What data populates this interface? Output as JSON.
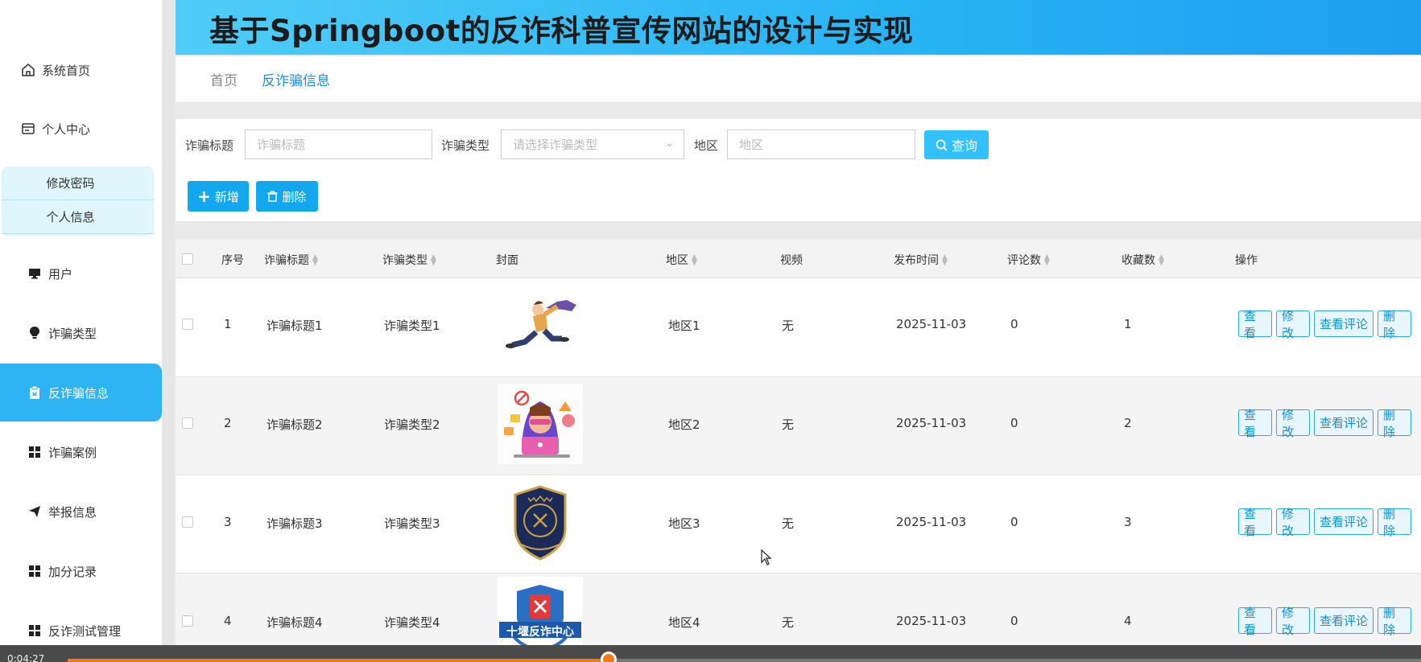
{
  "header": {
    "title": "基于Springboot的反诈科普宣传网站的设计与实现"
  },
  "sidebar": {
    "items": [
      {
        "label": "系统首页",
        "icon": "home-icon"
      },
      {
        "label": "个人中心",
        "icon": "profile-card-icon"
      },
      {
        "label": "用户",
        "icon": "monitor-icon"
      },
      {
        "label": "诈骗类型",
        "icon": "bulb-icon"
      },
      {
        "label": "反诈骗信息",
        "icon": "clipboard-icon",
        "active": true
      },
      {
        "label": "诈骗案例",
        "icon": "grid-icon"
      },
      {
        "label": "举报信息",
        "icon": "paper-plane-icon"
      },
      {
        "label": "加分记录",
        "icon": "grid-icon"
      },
      {
        "label": "反诈测试管理",
        "icon": "grid-icon"
      }
    ],
    "submenu": [
      {
        "label": "修改密码"
      },
      {
        "label": "个人信息"
      }
    ]
  },
  "breadcrumb": {
    "home": "首页",
    "current": "反诈骗信息"
  },
  "search": {
    "title_label": "诈骗标题",
    "title_placeholder": "诈骗标题",
    "type_label": "诈骗类型",
    "type_placeholder": "请选择诈骗类型",
    "region_label": "地区",
    "region_placeholder": "地区",
    "query_button": "查询"
  },
  "actions": {
    "add": "新增",
    "delete": "删除"
  },
  "table": {
    "columns": [
      "序号",
      "诈骗标题",
      "诈骗类型",
      "封面",
      "地区",
      "视频",
      "发布时间",
      "评论数",
      "收藏数",
      "操作"
    ],
    "ops": [
      "查看",
      "修改",
      "查看评论",
      "删除"
    ],
    "rows": [
      {
        "index": "1",
        "title": "诈骗标题1",
        "type": "诈骗类型1",
        "cover": "running-man-image",
        "region": "地区1",
        "video": "无",
        "date": "2025-11-03",
        "comments": "0",
        "favorites": "1"
      },
      {
        "index": "2",
        "title": "诈骗标题2",
        "type": "诈骗类型2",
        "cover": "hacker-laptop-image",
        "region": "地区2",
        "video": "无",
        "date": "2025-11-03",
        "comments": "0",
        "favorites": "2"
      },
      {
        "index": "3",
        "title": "诈骗标题3",
        "type": "诈骗类型3",
        "cover": "police-badge-image",
        "region": "地区3",
        "video": "无",
        "date": "2025-11-03",
        "comments": "0",
        "favorites": "3"
      },
      {
        "index": "4",
        "title": "诈骗标题4",
        "type": "诈骗类型4",
        "cover": "anti-fraud-center-logo",
        "cover_text": "十堰反诈中心",
        "region": "地区4",
        "video": "无",
        "date": "2025-11-03",
        "comments": "0",
        "favorites": "4"
      }
    ]
  },
  "player": {
    "time": "0:04:27",
    "progress": 0.4
  },
  "colors": {
    "accent": "#2eb4f5",
    "button": "#13a7ee",
    "link": "#1f8ed8"
  }
}
